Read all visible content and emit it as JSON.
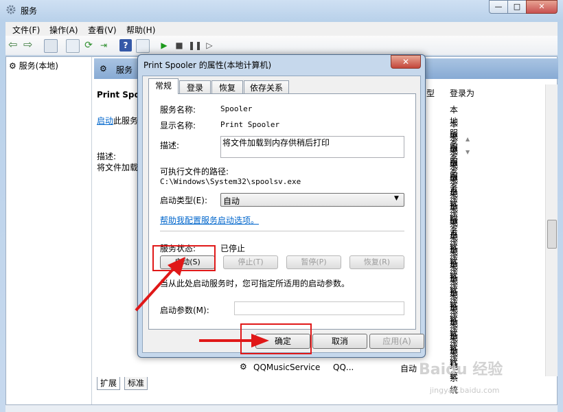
{
  "window": {
    "title": "服务"
  },
  "menu": [
    "文件(F)",
    "操作(A)",
    "查看(V)",
    "帮助(H)"
  ],
  "tree": {
    "root": "服务(本地)"
  },
  "detail": {
    "header": "服务",
    "service_name_short": "Print Spoo",
    "start_link": "启动",
    "start_suffix": "此服务",
    "desc_label": "描述:",
    "desc_text": "将文件加载"
  },
  "list": {
    "col_type": "型",
    "col_login": "登录为",
    "login_values": [
      "本地服务",
      "本地服务",
      "本地服务",
      "本地服务",
      "本地系统",
      "本地系统",
      "本地服务",
      "本地系统",
      "本地系统",
      "本地系统",
      "本地系统",
      "本地系统",
      "本地系统",
      "本地系统",
      "本地系统",
      "本地系统",
      "本地系统",
      "本地系统"
    ],
    "last_row": {
      "name": "QQMusicService",
      "desc": "QQ...",
      "startup": "自动"
    }
  },
  "bottom_tabs": [
    "扩展",
    "标准"
  ],
  "dialog": {
    "title": "Print Spooler 的属性(本地计算机)",
    "tabs": [
      "常规",
      "登录",
      "恢复",
      "依存关系"
    ],
    "service_name_label": "服务名称:",
    "service_name": "Spooler",
    "display_name_label": "显示名称:",
    "display_name": "Print Spooler",
    "description_label": "描述:",
    "description": "将文件加载到内存供稍后打印",
    "path_label": "可执行文件的路径:",
    "path": "C:\\Windows\\System32\\spoolsv.exe",
    "startup_label": "启动类型(E):",
    "startup_value": "自动",
    "help_link": "帮助我配置服务启动选项。",
    "status_label": "服务状态:",
    "status_value": "已停止",
    "btn_start": "启动(S)",
    "btn_stop": "停止(T)",
    "btn_pause": "暂停(P)",
    "btn_resume": "恢复(R)",
    "hint": "当从此处启动服务时，您可指定所适用的启动参数。",
    "param_label": "启动参数(M):",
    "param_value": "",
    "btn_ok": "确定",
    "btn_cancel": "取消",
    "btn_apply": "应用(A)"
  },
  "watermark": {
    "brand": "Baidu 经验",
    "url": "jingyan.baidu.com"
  },
  "colors": {
    "highlight": "#e01818",
    "link": "#0066cc"
  }
}
